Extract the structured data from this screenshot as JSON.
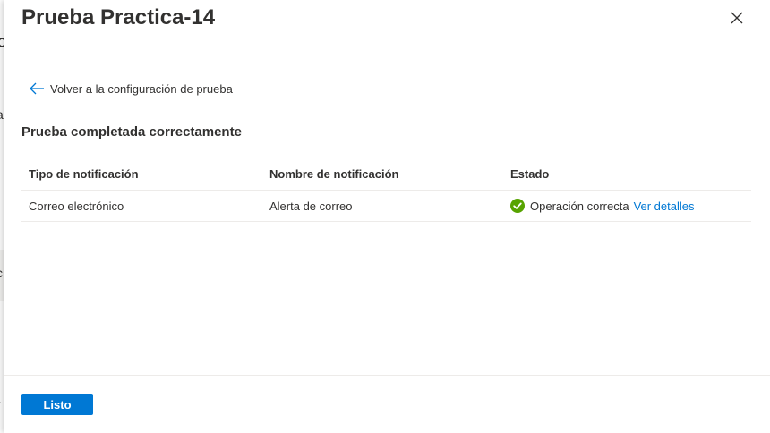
{
  "colors": {
    "accent": "#0078d4",
    "success": "#57a300",
    "text": "#323130",
    "divider": "#edebe9"
  },
  "background_fragments": [
    "o",
    "a",
    "i",
    "c",
    "r"
  ],
  "panel": {
    "title": "Prueba Practica-14",
    "close_icon": "close-icon"
  },
  "back_link": {
    "icon": "arrow-left-icon",
    "label": "Volver a la configuración de prueba"
  },
  "result": {
    "heading": "Prueba completada correctamente",
    "columns": [
      "Tipo de notificación",
      "Nombre de notificación",
      "Estado"
    ],
    "rows": [
      {
        "type": "Correo electrónico",
        "name": "Alerta de correo",
        "status_icon": "success-check-icon",
        "status": "Operación correcta",
        "details_link": "Ver detalles"
      }
    ]
  },
  "footer": {
    "done_label": "Listo"
  }
}
